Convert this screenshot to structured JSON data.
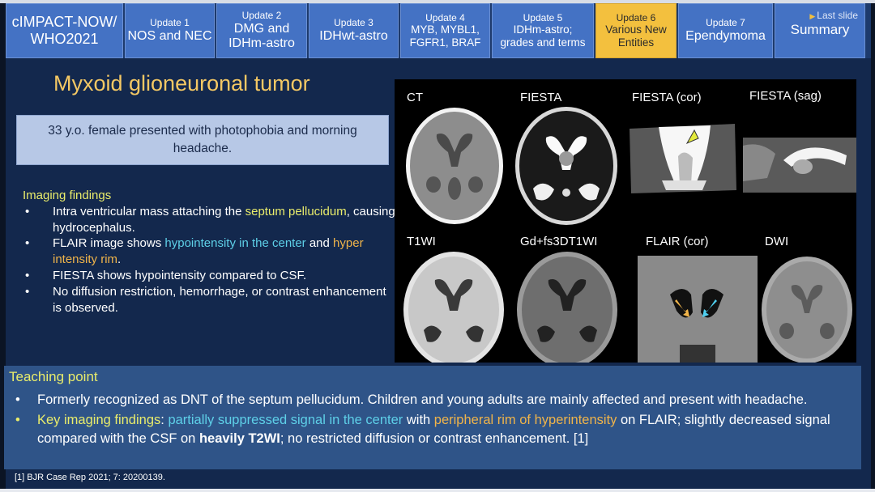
{
  "nav": {
    "tabs": [
      {
        "line1": "cIMPACT-NOW/",
        "line2": "WHO2021",
        "active": false
      },
      {
        "line1": "Update 1",
        "line2": "NOS and NEC",
        "active": false
      },
      {
        "line1": "Update 2",
        "line2": "DMG and",
        "line3": "IDHm-astro",
        "active": false
      },
      {
        "line1": "Update 3",
        "line2": "IDHwt-astro",
        "active": false
      },
      {
        "line1": "Update 4",
        "line2": "MYB, MYBL1,",
        "line3": "FGFR1, BRAF",
        "active": false
      },
      {
        "line1": "Update 5",
        "line2": "IDHm-astro;",
        "line3": "grades and terms",
        "active": false
      },
      {
        "line1": "Update 6",
        "line2": "Various New",
        "line3": "Entities",
        "active": true
      },
      {
        "line1": "Update 7",
        "line2": "Ependymoma",
        "active": false
      },
      {
        "line1": "Last slide",
        "line2": "Summary",
        "active": false
      }
    ],
    "active_color": "#f3c03e",
    "tab_color": "#4472c4"
  },
  "slide": {
    "title": "Myxoid glioneuronal tumor",
    "case_text": "33 y.o. female presented with photophobia and morning headache."
  },
  "imaging_findings": {
    "heading": "Imaging findings",
    "items": [
      {
        "parts": [
          "Intra ventricular mass attaching the ",
          "septum pellucidum",
          ", causing hydrocephalus."
        ]
      },
      {
        "parts": [
          "FLAIR image shows ",
          "hypointensity in the center",
          " and ",
          "hyper intensity rim",
          "."
        ]
      },
      {
        "text": "FIESTA shows hypointensity compared to CSF."
      },
      {
        "text": "No diffusion restriction, hemorrhage, or contrast enhancement is observed."
      }
    ]
  },
  "images": {
    "labels": [
      "CT",
      "FIESTA",
      "FIESTA (cor)",
      "FIESTA (sag)",
      "T1WI",
      "Gd+fs3DT1WI",
      "FLAIR (cor)",
      "DWI"
    ],
    "arrow_colors": {
      "fiesta_cor": "#e3ea3c",
      "flair_left": "#f0b44a",
      "flair_right": "#4fd0f0"
    }
  },
  "teaching_point": {
    "heading": "Teaching point",
    "item1": "Formerly recognized as DNT of the septum pellucidum. Children and young adults are mainly affected and present with headache.",
    "item2": {
      "label": "Key imaging findings",
      "colon": ": ",
      "cyan": "partially suppressed signal in the center",
      "with": " with ",
      "orange": "peripheral rim of hyperintensity",
      "rest1": " on FLAIR; slightly decreased signal compared with the CSF on ",
      "bold": "heavily T2WI",
      "rest2": "; no restricted diffusion or contrast enhancement. [1]"
    }
  },
  "reference": "[1] BJR Case Rep 2021; 7: 20200139."
}
